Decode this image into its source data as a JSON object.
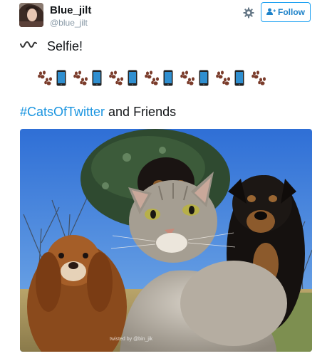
{
  "tweet": {
    "author": {
      "display_name": "Blue_jilt",
      "handle": "@blue_jilt"
    },
    "actions": {
      "settings_icon": "gear-icon",
      "follow_label": "Follow",
      "follow_icon": "add-user-icon"
    },
    "text_line1": "Selfie!",
    "wave_icon": "wave-icon",
    "emoji_row": [
      "paw",
      "phone",
      "paw",
      "phone",
      "paw",
      "phone",
      "paw",
      "phone",
      "paw",
      "phone",
      "paw",
      "phone",
      "paw"
    ],
    "hashtag": "#CatsOfTwitter",
    "text_after_hashtag": " and Friends",
    "photo": {
      "watermark": "twisted by @bin_jik"
    },
    "colors": {
      "link": "#1b95e0",
      "follow_border": "#1da1f2",
      "paw": "#7a3b2a",
      "phone": "#2f8fd0"
    }
  }
}
